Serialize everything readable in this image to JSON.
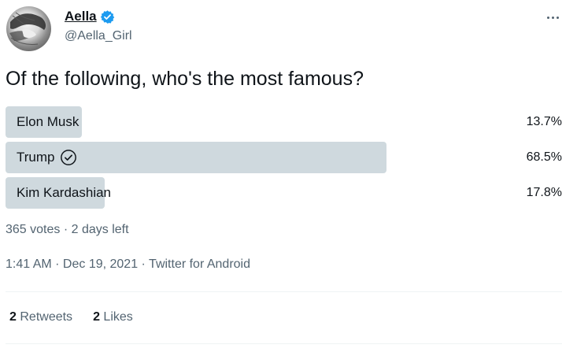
{
  "author": {
    "display_name": "Aella",
    "handle": "@Aella_Girl",
    "verified_color": "#1d9bf0"
  },
  "icons": {
    "verified": "verified-badge-icon",
    "more": "more-options-icon",
    "winner": "check-circle-icon"
  },
  "tweet": {
    "question": "Of the following, who's the most famous?"
  },
  "poll": {
    "options": [
      {
        "label": "Elon Musk",
        "percent_text": "13.7%",
        "share": 0.137,
        "winner": false
      },
      {
        "label": "Trump",
        "percent_text": "68.5%",
        "share": 0.685,
        "winner": true
      },
      {
        "label": "Kim Kardashian",
        "percent_text": "17.8%",
        "share": 0.178,
        "winner": false
      }
    ],
    "bar_color": "#cfd9de",
    "meta": "365 votes · 2 days left"
  },
  "meta": {
    "time": "1:41 AM",
    "sep1": " · ",
    "date": "Dec 19, 2021",
    "sep2": " · ",
    "source": "Twitter for Android"
  },
  "stats": {
    "retweets_count": "2",
    "retweets_label": "Retweets",
    "likes_count": "2",
    "likes_label": "Likes"
  }
}
